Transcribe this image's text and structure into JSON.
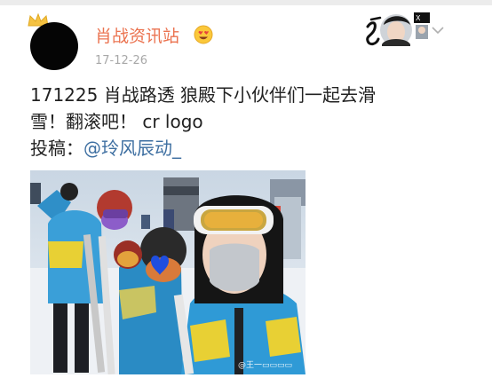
{
  "post": {
    "username": "肖战资讯站",
    "timestamp": "17-12-26",
    "text_line1": "171225 肖战路透 狼殿下小伙伴们一起去滑",
    "text_line2": "雪！翻滚吧！ cr logo",
    "submit_label": "投稿：",
    "submit_mention": "@玲风辰动_",
    "image_watermark": "@王一▭▭▭▭"
  },
  "icons": {
    "crown": "crown-icon",
    "emoji": "heart-eyes-emoji-icon",
    "badge": "fan-badge-icon",
    "chevron": "chevron-down-icon"
  },
  "colors": {
    "username": "#eb7350",
    "mention": "#3e6fa1",
    "timestamp": "#a8a8a8",
    "text": "#222222"
  }
}
